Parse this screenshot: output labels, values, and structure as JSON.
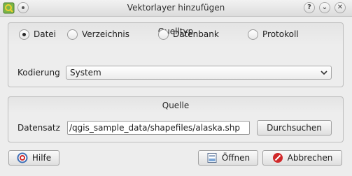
{
  "window": {
    "title": "Vektorlayer hinzufügen",
    "buttons": {
      "help": "?",
      "minimize": "⌄",
      "close": "✕"
    }
  },
  "source_type": {
    "title": "Quelltyp",
    "options": [
      {
        "label": "Datei",
        "checked": true
      },
      {
        "label": "Verzeichnis",
        "checked": false
      },
      {
        "label": "Datenbank",
        "checked": false
      },
      {
        "label": "Protokoll",
        "checked": false
      }
    ],
    "encoding_label": "Kodierung",
    "encoding_value": "System"
  },
  "source": {
    "title": "Quelle",
    "dataset_label": "Datensatz",
    "dataset_value": "/qgis_sample_data/shapefiles/alaska.shp",
    "browse_label": "Durchsuchen"
  },
  "footer": {
    "help_label": "Hilfe",
    "open_label": "Öffnen",
    "cancel_label": "Abbrechen"
  },
  "colors": {
    "cancel_icon": "#d0282a",
    "help_icon": "#3f6fb5"
  }
}
